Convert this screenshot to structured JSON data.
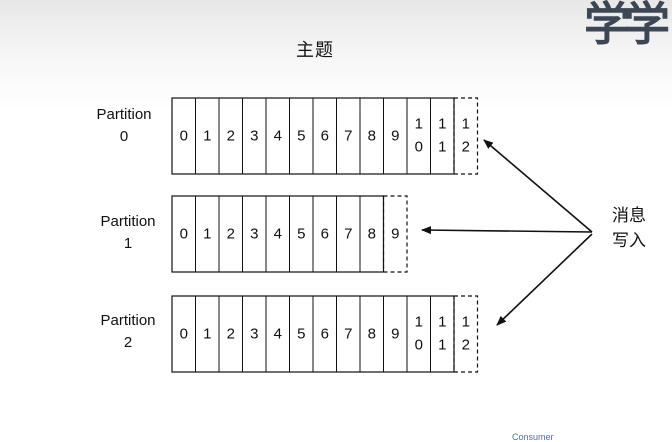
{
  "title": "主题",
  "watermark": "学学",
  "partitions": [
    {
      "label_line1": "Partition",
      "label_line2": "0",
      "offsets": [
        "0",
        "1",
        "2",
        "3",
        "4",
        "5",
        "6",
        "7",
        "8",
        "9",
        "10",
        "11"
      ],
      "next_offset": "12"
    },
    {
      "label_line1": "Partition",
      "label_line2": "1",
      "offsets": [
        "0",
        "1",
        "2",
        "3",
        "4",
        "5",
        "6",
        "7",
        "8"
      ],
      "next_offset": "9"
    },
    {
      "label_line1": "Partition",
      "label_line2": "2",
      "offsets": [
        "0",
        "1",
        "2",
        "3",
        "4",
        "5",
        "6",
        "7",
        "8",
        "9",
        "10",
        "11"
      ],
      "next_offset": "12"
    }
  ],
  "write_label": {
    "line1": "消息",
    "line2": "写入"
  },
  "consumer_label": "Consumer",
  "colors": {
    "line": "#111111"
  }
}
